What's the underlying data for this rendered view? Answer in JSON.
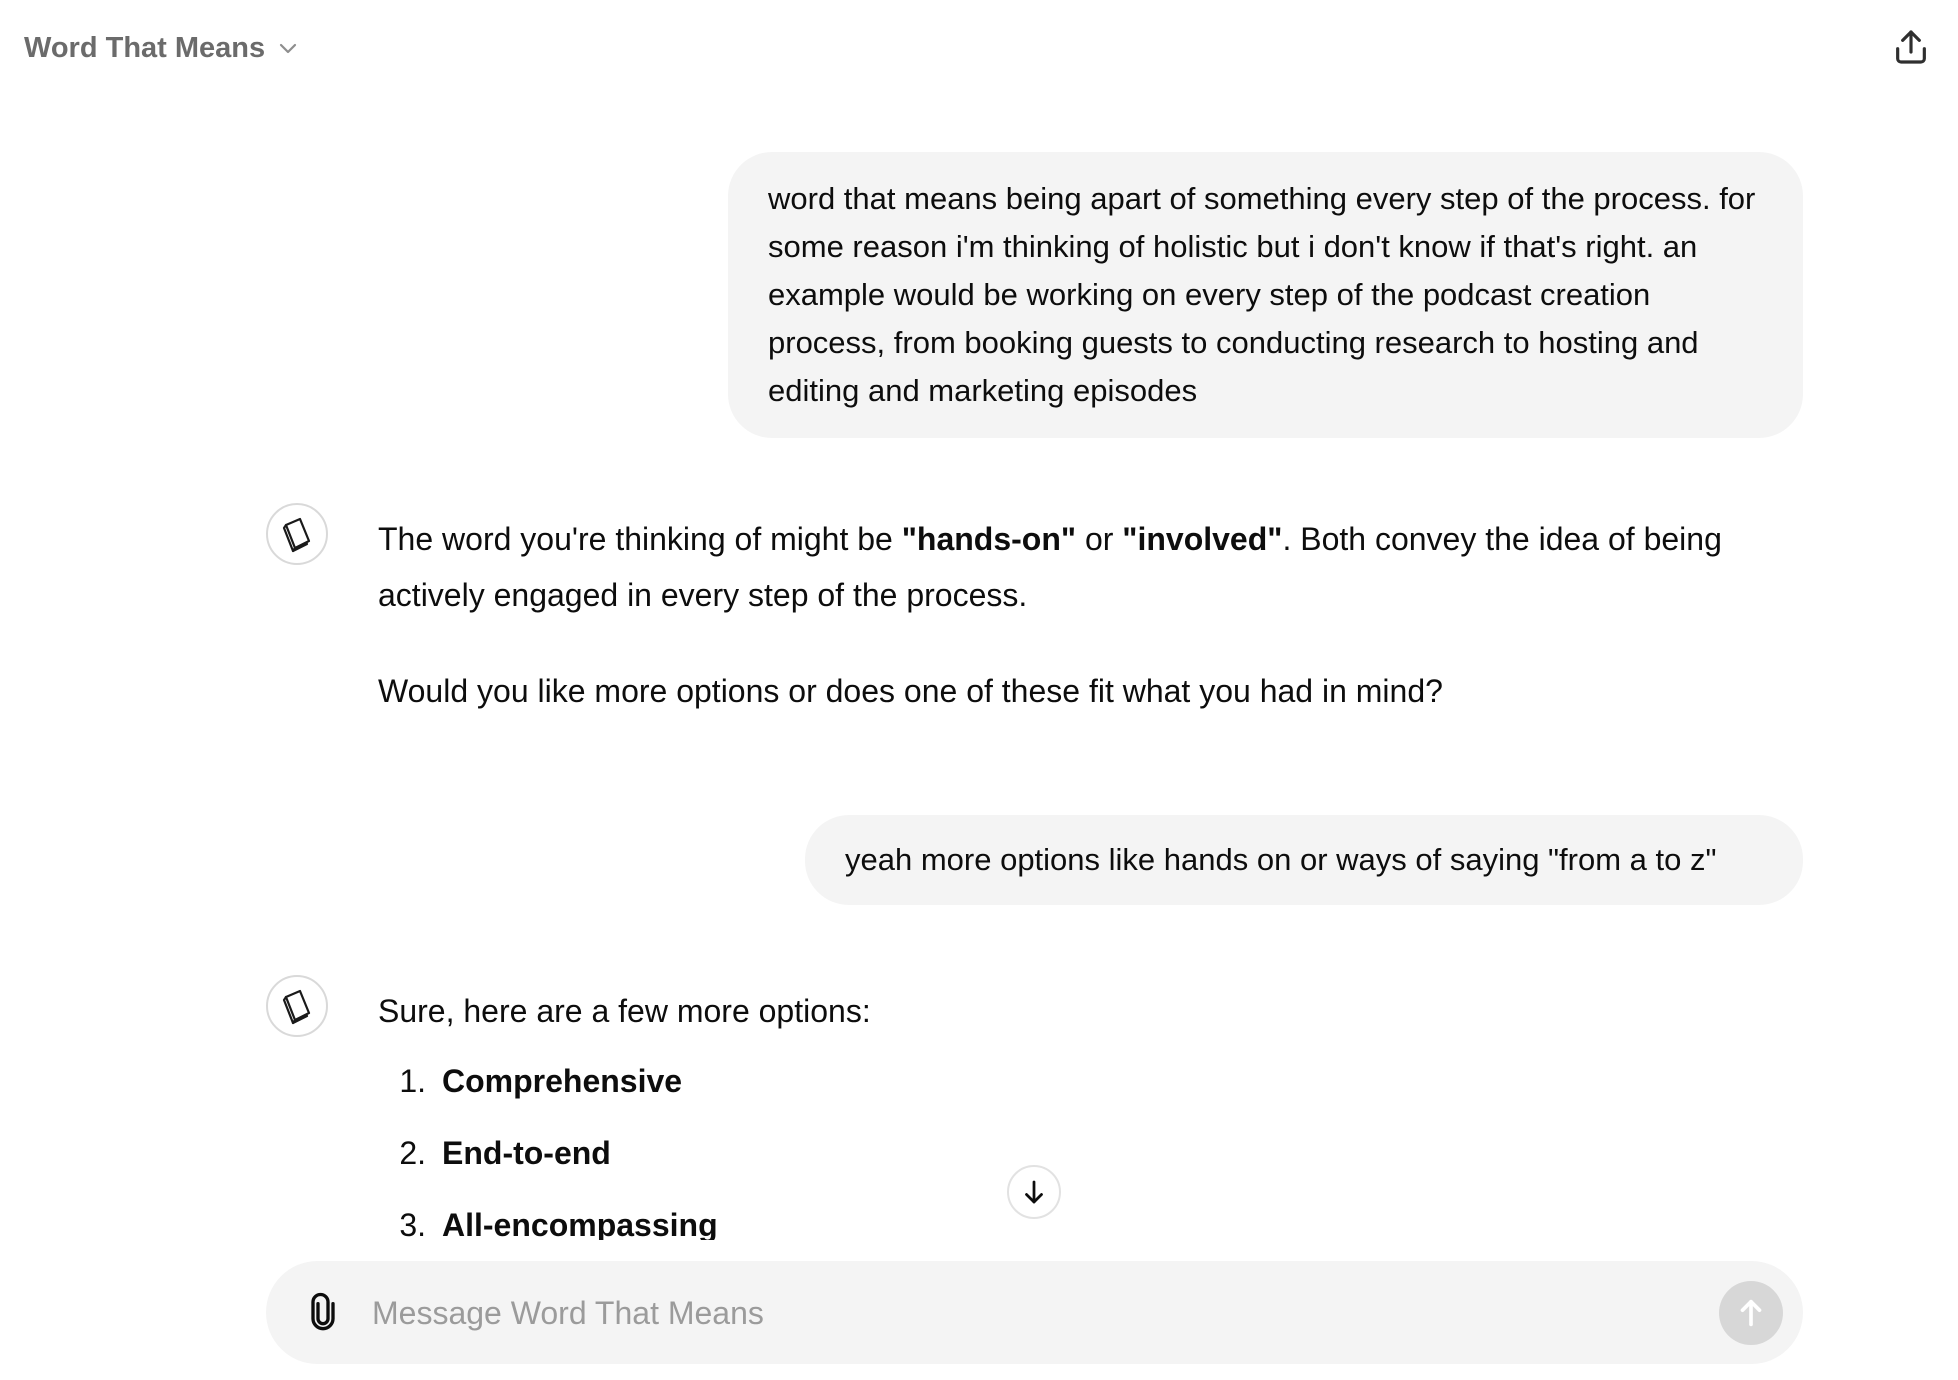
{
  "header": {
    "title": "Word That Means",
    "chevron_icon": "chevron-down-icon",
    "share_icon": "share-upload-icon"
  },
  "conversation": [
    {
      "role": "user",
      "text": "word that means being apart of something every step of the process. for some reason i'm thinking of holistic but i don't know if that's right. an example would be working on every step of the podcast creation process, from booking guests to conducting research to hosting and editing and marketing episodes"
    },
    {
      "role": "assistant",
      "avatar_icon": "book-icon",
      "p1_before": "The word you're thinking of might be ",
      "p1_bold1": "\"hands-on\"",
      "p1_mid": " or ",
      "p1_bold2": "\"involved\"",
      "p1_after": ". Both convey the idea of being actively engaged in every step of the process.",
      "p2": "Would you like more options or does one of these fit what you had in mind?"
    },
    {
      "role": "user",
      "text": "yeah more options like hands on or ways of saying \"from a to z\""
    },
    {
      "role": "assistant",
      "avatar_icon": "book-icon",
      "intro": "Sure, here are a few more options:",
      "options": [
        {
          "num": "1.",
          "label": "Comprehensive"
        },
        {
          "num": "2.",
          "label": "End-to-end"
        },
        {
          "num": "3.",
          "label": "All-encompassing"
        }
      ]
    }
  ],
  "scroll_button_icon": "arrow-down-icon",
  "composer": {
    "placeholder": "Message Word That Means",
    "attach_icon": "paperclip-icon",
    "send_icon": "arrow-up-icon"
  },
  "colors": {
    "user_bubble": "#f4f4f4",
    "composer_bg": "#f4f4f4",
    "send_disabled": "#d7d7d7",
    "header_title": "#6b6b6b",
    "placeholder": "#9b9b9b"
  }
}
